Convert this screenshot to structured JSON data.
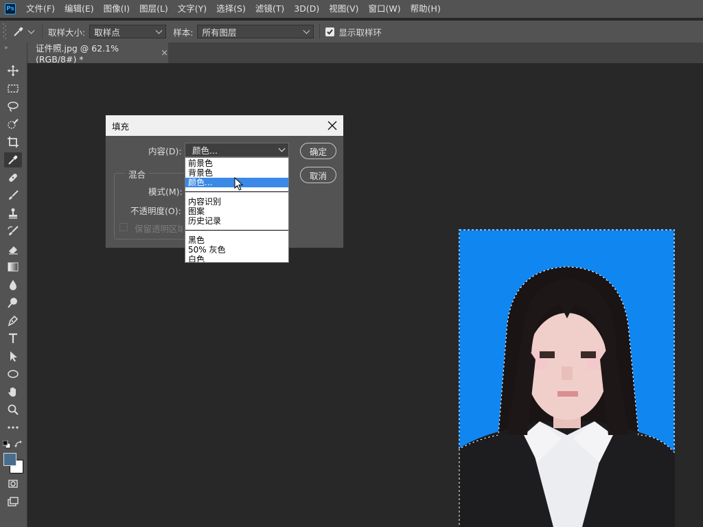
{
  "app": {
    "logo_text": "Ps"
  },
  "menu": [
    "文件(F)",
    "编辑(E)",
    "图像(I)",
    "图层(L)",
    "文字(Y)",
    "选择(S)",
    "滤镜(T)",
    "3D(D)",
    "视图(V)",
    "窗口(W)",
    "帮助(H)"
  ],
  "options_bar": {
    "sample_size_label": "取样大小:",
    "sample_size_value": "取样点",
    "sample_label": "样本:",
    "sample_value": "所有图层",
    "show_ring_label": "显示取样环",
    "show_ring_checked": true
  },
  "document_tab": {
    "title": "证件照.jpg @ 62.1%(RGB/8#) *",
    "close": "×"
  },
  "toolbar": {
    "tools": [
      "move-tool",
      "marquee-tool",
      "lasso-tool",
      "quick-select-tool",
      "crop-tool",
      "eyedropper-tool",
      "healing-brush-tool",
      "brush-tool",
      "clone-stamp-tool",
      "history-brush-tool",
      "eraser-tool",
      "gradient-tool",
      "blur-tool",
      "dodge-tool",
      "pen-tool",
      "type-tool",
      "path-select-tool",
      "ellipse-tool",
      "hand-tool",
      "zoom-tool",
      "more-tools"
    ],
    "selected_tool": "eyedropper-tool",
    "foreground_color": "#4a6d8c",
    "background_color": "#ffffff"
  },
  "fill_dialog": {
    "title": "填充",
    "content_label": "内容(D):",
    "content_value": "颜色...",
    "blend_group_label": "混合",
    "mode_label": "模式(M):",
    "opacity_label": "不透明度(O):",
    "preserve_transparency_label": "保留透明区域",
    "ok_button": "确定",
    "cancel_button": "取消",
    "options": [
      [
        "前景色",
        "背景色",
        "颜色..."
      ],
      [
        "内容识别",
        "图案",
        "历史记录"
      ],
      [
        "黑色",
        "50% 灰色",
        "白色"
      ]
    ],
    "highlighted_option": "颜色..."
  },
  "colors": {
    "photo_background": "#1086f0",
    "highlight": "#3a89e6"
  }
}
